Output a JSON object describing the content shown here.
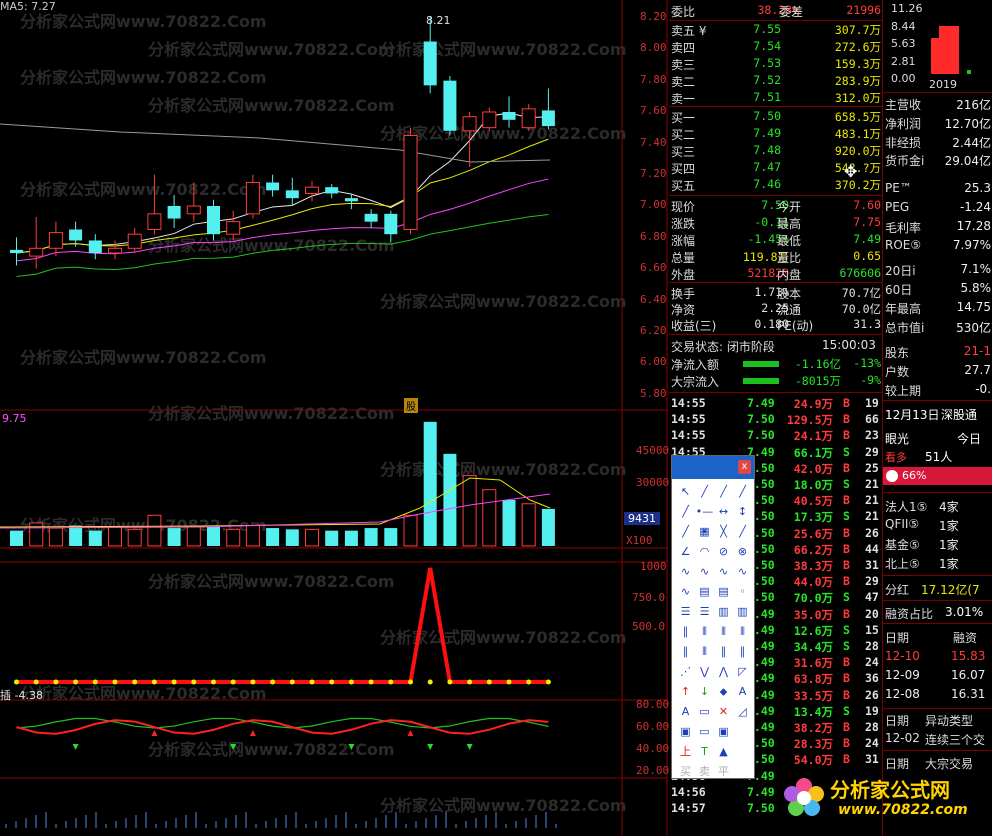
{
  "chart_header": {
    "ma_label": "MA5: 7.27",
    "price_marker": "8.21"
  },
  "price_axis": [
    "8.20",
    "8.00",
    "7.80",
    "7.60",
    "7.40",
    "7.20",
    "7.00",
    "6.80",
    "6.60",
    "6.40",
    "6.20",
    "6.00",
    "5.80"
  ],
  "volume_axis": [
    "45000",
    "30000",
    "9431",
    "X100"
  ],
  "volume_left_label": "9.75",
  "indicator1_axis": [
    "1000",
    "750.0",
    "500.0"
  ],
  "indicator2_label": "插 -4.38",
  "indicator2_axis": [
    "80.00",
    "60.00",
    "40.00",
    "20.00"
  ],
  "event_badge": "股",
  "watermark": "分析家公式网www.70822.Com",
  "chart_data": {
    "type": "bar",
    "title": "",
    "candles": [
      {
        "o": 6.72,
        "c": 6.7,
        "h": 6.8,
        "l": 6.62
      },
      {
        "o": 6.68,
        "c": 6.73,
        "h": 6.93,
        "l": 6.6
      },
      {
        "o": 6.73,
        "c": 6.83,
        "h": 6.9,
        "l": 6.68
      },
      {
        "o": 6.85,
        "c": 6.78,
        "h": 6.9,
        "l": 6.74
      },
      {
        "o": 6.78,
        "c": 6.7,
        "h": 6.82,
        "l": 6.66
      },
      {
        "o": 6.7,
        "c": 6.73,
        "h": 6.78,
        "l": 6.66
      },
      {
        "o": 6.73,
        "c": 6.82,
        "h": 6.86,
        "l": 6.7
      },
      {
        "o": 6.85,
        "c": 6.95,
        "h": 7.2,
        "l": 6.82
      },
      {
        "o": 7.0,
        "c": 6.92,
        "h": 7.07,
        "l": 6.86
      },
      {
        "o": 6.95,
        "c": 7.0,
        "h": 7.15,
        "l": 6.9
      },
      {
        "o": 7.0,
        "c": 6.82,
        "h": 7.04,
        "l": 6.78
      },
      {
        "o": 6.82,
        "c": 6.9,
        "h": 6.97,
        "l": 6.78
      },
      {
        "o": 6.95,
        "c": 7.15,
        "h": 7.2,
        "l": 6.92
      },
      {
        "o": 7.15,
        "c": 7.1,
        "h": 7.2,
        "l": 7.06
      },
      {
        "o": 7.1,
        "c": 7.05,
        "h": 7.18,
        "l": 7.0
      },
      {
        "o": 7.08,
        "c": 7.12,
        "h": 7.16,
        "l": 7.03
      },
      {
        "o": 7.12,
        "c": 7.08,
        "h": 7.14,
        "l": 7.05
      },
      {
        "o": 7.05,
        "c": 7.03,
        "h": 7.08,
        "l": 6.98
      },
      {
        "o": 6.95,
        "c": 6.9,
        "h": 6.98,
        "l": 6.86
      },
      {
        "o": 6.95,
        "c": 6.82,
        "h": 6.97,
        "l": 6.77
      },
      {
        "o": 6.85,
        "c": 7.45,
        "h": 7.5,
        "l": 6.82
      },
      {
        "o": 8.05,
        "c": 7.77,
        "h": 8.21,
        "l": 7.72
      },
      {
        "o": 7.8,
        "c": 7.48,
        "h": 7.83,
        "l": 7.45
      },
      {
        "o": 7.48,
        "c": 7.57,
        "h": 7.6,
        "l": 7.25
      },
      {
        "o": 7.5,
        "c": 7.6,
        "h": 7.63,
        "l": 7.48
      },
      {
        "o": 7.6,
        "c": 7.55,
        "h": 7.7,
        "l": 7.5
      },
      {
        "o": 7.5,
        "c": 7.62,
        "h": 7.65,
        "l": 7.48
      },
      {
        "o": 7.61,
        "c": 7.51,
        "h": 7.75,
        "l": 7.49
      }
    ],
    "volumes": [
      12,
      18,
      14,
      16,
      12,
      15,
      13,
      24,
      14,
      15,
      15,
      13,
      16,
      14,
      13,
      13,
      12,
      12,
      14,
      14,
      24,
      97,
      72,
      55,
      44,
      36,
      33,
      29
    ],
    "indicator1": [
      0,
      0,
      0,
      0,
      0,
      0,
      0,
      0,
      0,
      0,
      0,
      0,
      0,
      0,
      0,
      0,
      0,
      0,
      0,
      0,
      0,
      1000,
      0,
      0,
      0,
      0,
      0,
      0
    ],
    "ylim": [
      5.8,
      8.2
    ]
  },
  "order_book": {
    "header": {
      "label1": "委比",
      "value1": "38.28%",
      "label2": "委差",
      "value2": "21996"
    },
    "asks": [
      {
        "label": "卖五 ¥",
        "price": "7.55",
        "vol": "307.7万"
      },
      {
        "label": "卖四",
        "price": "7.54",
        "vol": "272.6万"
      },
      {
        "label": "卖三",
        "price": "7.53",
        "vol": "159.3万"
      },
      {
        "label": "卖二",
        "price": "7.52",
        "vol": "283.9万"
      },
      {
        "label": "卖一",
        "price": "7.51",
        "vol": "312.0万"
      }
    ],
    "bids": [
      {
        "label": "买一",
        "price": "7.50",
        "vol": "658.5万"
      },
      {
        "label": "买二",
        "price": "7.49",
        "vol": "483.1万"
      },
      {
        "label": "买三",
        "price": "7.48",
        "vol": "920.0万"
      },
      {
        "label": "买四",
        "price": "7.47",
        "vol": "54?.?万"
      },
      {
        "label": "买五",
        "price": "7.46",
        "vol": "370.2万"
      }
    ]
  },
  "quote": [
    {
      "l1": "现价",
      "v1": "7.50",
      "l2": "今开",
      "v2": "7.60"
    },
    {
      "l1": "涨跌",
      "v1": "-0.11",
      "l2": "最高",
      "v2": "7.75"
    },
    {
      "l1": "涨幅",
      "v1": "-1.45%",
      "l2": "最低",
      "v2": "7.49"
    },
    {
      "l1": "总量",
      "v1": "119.8万",
      "l2": "量比",
      "v2": "0.65"
    },
    {
      "l1": "外盘",
      "v1": "521820",
      "l2": "内盘",
      "v2": "676606"
    }
  ],
  "quote2": [
    {
      "l1": "换手",
      "v1": "1.71%",
      "l2": "股本",
      "v2": "70.7亿"
    },
    {
      "l1": "净资",
      "v1": "2.25",
      "l2": "流通",
      "v2": "70.0亿"
    },
    {
      "l1": "收益(三)",
      "v1": "0.180",
      "l2": "PE(动)",
      "v2": "31.3"
    }
  ],
  "trade_status": {
    "label": "交易状态: 闭市阶段",
    "time": "15:00:03"
  },
  "flows": [
    {
      "label": "净流入额",
      "value": "-1.16亿",
      "pct": "-13%"
    },
    {
      "label": "大宗流入",
      "value": "-8015万",
      "pct": "-9%"
    }
  ],
  "trades": [
    {
      "t": "14:55",
      "p": "7.49",
      "v": "24.9万",
      "d": "B",
      "n": "19"
    },
    {
      "t": "14:55",
      "p": "7.50",
      "v": "129.5万",
      "d": "B",
      "n": "66"
    },
    {
      "t": "14:55",
      "p": "7.50",
      "v": "24.1万",
      "d": "B",
      "n": "23"
    },
    {
      "t": "14:55",
      "p": "7.49",
      "v": "66.1万",
      "d": "S",
      "n": "29"
    },
    {
      "t": "14:55",
      "p": "7.50",
      "v": "42.0万",
      "d": "B",
      "n": "25"
    },
    {
      "t": "14:55",
      "p": "7.50",
      "v": "18.0万",
      "d": "S",
      "n": "21"
    },
    {
      "t": "14:55",
      "p": "7.50",
      "v": "40.5万",
      "d": "B",
      "n": "21"
    },
    {
      "t": "14:55",
      "p": "7.50",
      "v": "17.3万",
      "d": "S",
      "n": "21"
    },
    {
      "t": "14:55",
      "p": "7.50",
      "v": "25.6万",
      "d": "B",
      "n": "26"
    },
    {
      "t": "14:55",
      "p": "7.50",
      "v": "66.2万",
      "d": "B",
      "n": "44"
    },
    {
      "t": "14:55",
      "p": "7.50",
      "v": "38.3万",
      "d": "B",
      "n": "31"
    },
    {
      "t": "14:55",
      "p": "7.50",
      "v": "44.0万",
      "d": "B",
      "n": "29"
    },
    {
      "t": "14:55",
      "p": "7.50",
      "v": "70.0万",
      "d": "S",
      "n": "47"
    },
    {
      "t": "14:55",
      "p": "7.49",
      "v": "35.0万",
      "d": "B",
      "n": "20"
    },
    {
      "t": "14:55",
      "p": "7.49",
      "v": "12.6万",
      "d": "S",
      "n": "15"
    },
    {
      "t": "14:55",
      "p": "7.49",
      "v": "34.4万",
      "d": "S",
      "n": "28"
    },
    {
      "t": "14:55",
      "p": "7.49",
      "v": "31.6万",
      "d": "B",
      "n": "24"
    },
    {
      "t": "14:55",
      "p": "7.49",
      "v": "63.8万",
      "d": "B",
      "n": "36"
    },
    {
      "t": "14:55",
      "p": "7.49",
      "v": "33.5万",
      "d": "B",
      "n": "26"
    },
    {
      "t": "14:55",
      "p": "7.49",
      "v": "13.4万",
      "d": "S",
      "n": "19"
    },
    {
      "t": "14:55",
      "p": "7.49",
      "v": "38.2万",
      "d": "B",
      "n": "28"
    },
    {
      "t": "14:55",
      "p": "7.50",
      "v": "28.3万",
      "d": "B",
      "n": "24"
    },
    {
      "t": "14:55",
      "p": "7.50",
      "v": "54.0万",
      "d": "B",
      "n": "31"
    },
    {
      "t": "14:56",
      "p": "7.49",
      "v": "",
      "d": "",
      "n": ""
    },
    {
      "t": "14:56",
      "p": "7.49",
      "v": "",
      "d": "",
      "n": ""
    },
    {
      "t": "14:57",
      "p": "7.50",
      "v": "",
      "d": "",
      "n": ""
    }
  ],
  "mini_chart": {
    "axis": [
      "11.26",
      "8.44",
      "5.63",
      "2.81",
      "0.00"
    ],
    "year": "2019"
  },
  "fundamentals": [
    {
      "l": "主营收",
      "v": "216亿"
    },
    {
      "l": "净利润",
      "v": "12.70亿"
    },
    {
      "l": "非经损",
      "v": "2.44亿"
    },
    {
      "l": "货币金i",
      "v": "29.04亿"
    },
    {
      "l": "PE™",
      "v": "25.3"
    },
    {
      "l": "PEG",
      "v": "-1.24"
    },
    {
      "l": "毛利率",
      "v": "17.28"
    },
    {
      "l": "ROE⑤",
      "v": "7.97%"
    },
    {
      "l": "20日i",
      "v": "7.1%"
    },
    {
      "l": "60日",
      "v": "5.8%"
    },
    {
      "l": "年最高",
      "v": "14.75"
    },
    {
      "l": "总市值i",
      "v": "530亿"
    },
    {
      "l": "股东",
      "v": "21-1"
    },
    {
      "l": "户数",
      "v": "27.7"
    },
    {
      "l": "较上期",
      "v": "-0."
    }
  ],
  "news": {
    "date": "12月13日",
    "source": "深股通",
    "eye": "眼光",
    "today": "今日",
    "bull": "看多",
    "count": "51人",
    "pct": "66%"
  },
  "holders": [
    {
      "l": "法人1⑤",
      "v": "4家"
    },
    {
      "l": "QFII⑤",
      "v": "1家"
    },
    {
      "l": "基金⑤",
      "v": "1家"
    },
    {
      "l": "北上⑤",
      "v": "1家"
    }
  ],
  "dividend": {
    "l": "分红",
    "v": "17.12亿(7"
  },
  "margin": {
    "l": "融资占比",
    "v": "3.01%"
  },
  "margin_table": {
    "h1": "日期",
    "h2": "融资",
    "rows": [
      {
        "d": "12-10",
        "v": "15.83"
      },
      {
        "d": "12-09",
        "v": "16.07"
      },
      {
        "d": "12-08",
        "v": "16.31"
      }
    ]
  },
  "events": {
    "h1": "日期",
    "h2": "异动类型",
    "rows": [
      {
        "d": "12-02",
        "v": "连续三个交"
      }
    ]
  },
  "block_trade": {
    "h1": "日期",
    "h2": "大宗交易"
  },
  "logo": {
    "text": "分析家公式网",
    "url": "www.70822.com"
  },
  "toolbox": {
    "close": "x",
    "row_labels": [
      "买",
      "卖",
      "平"
    ]
  }
}
